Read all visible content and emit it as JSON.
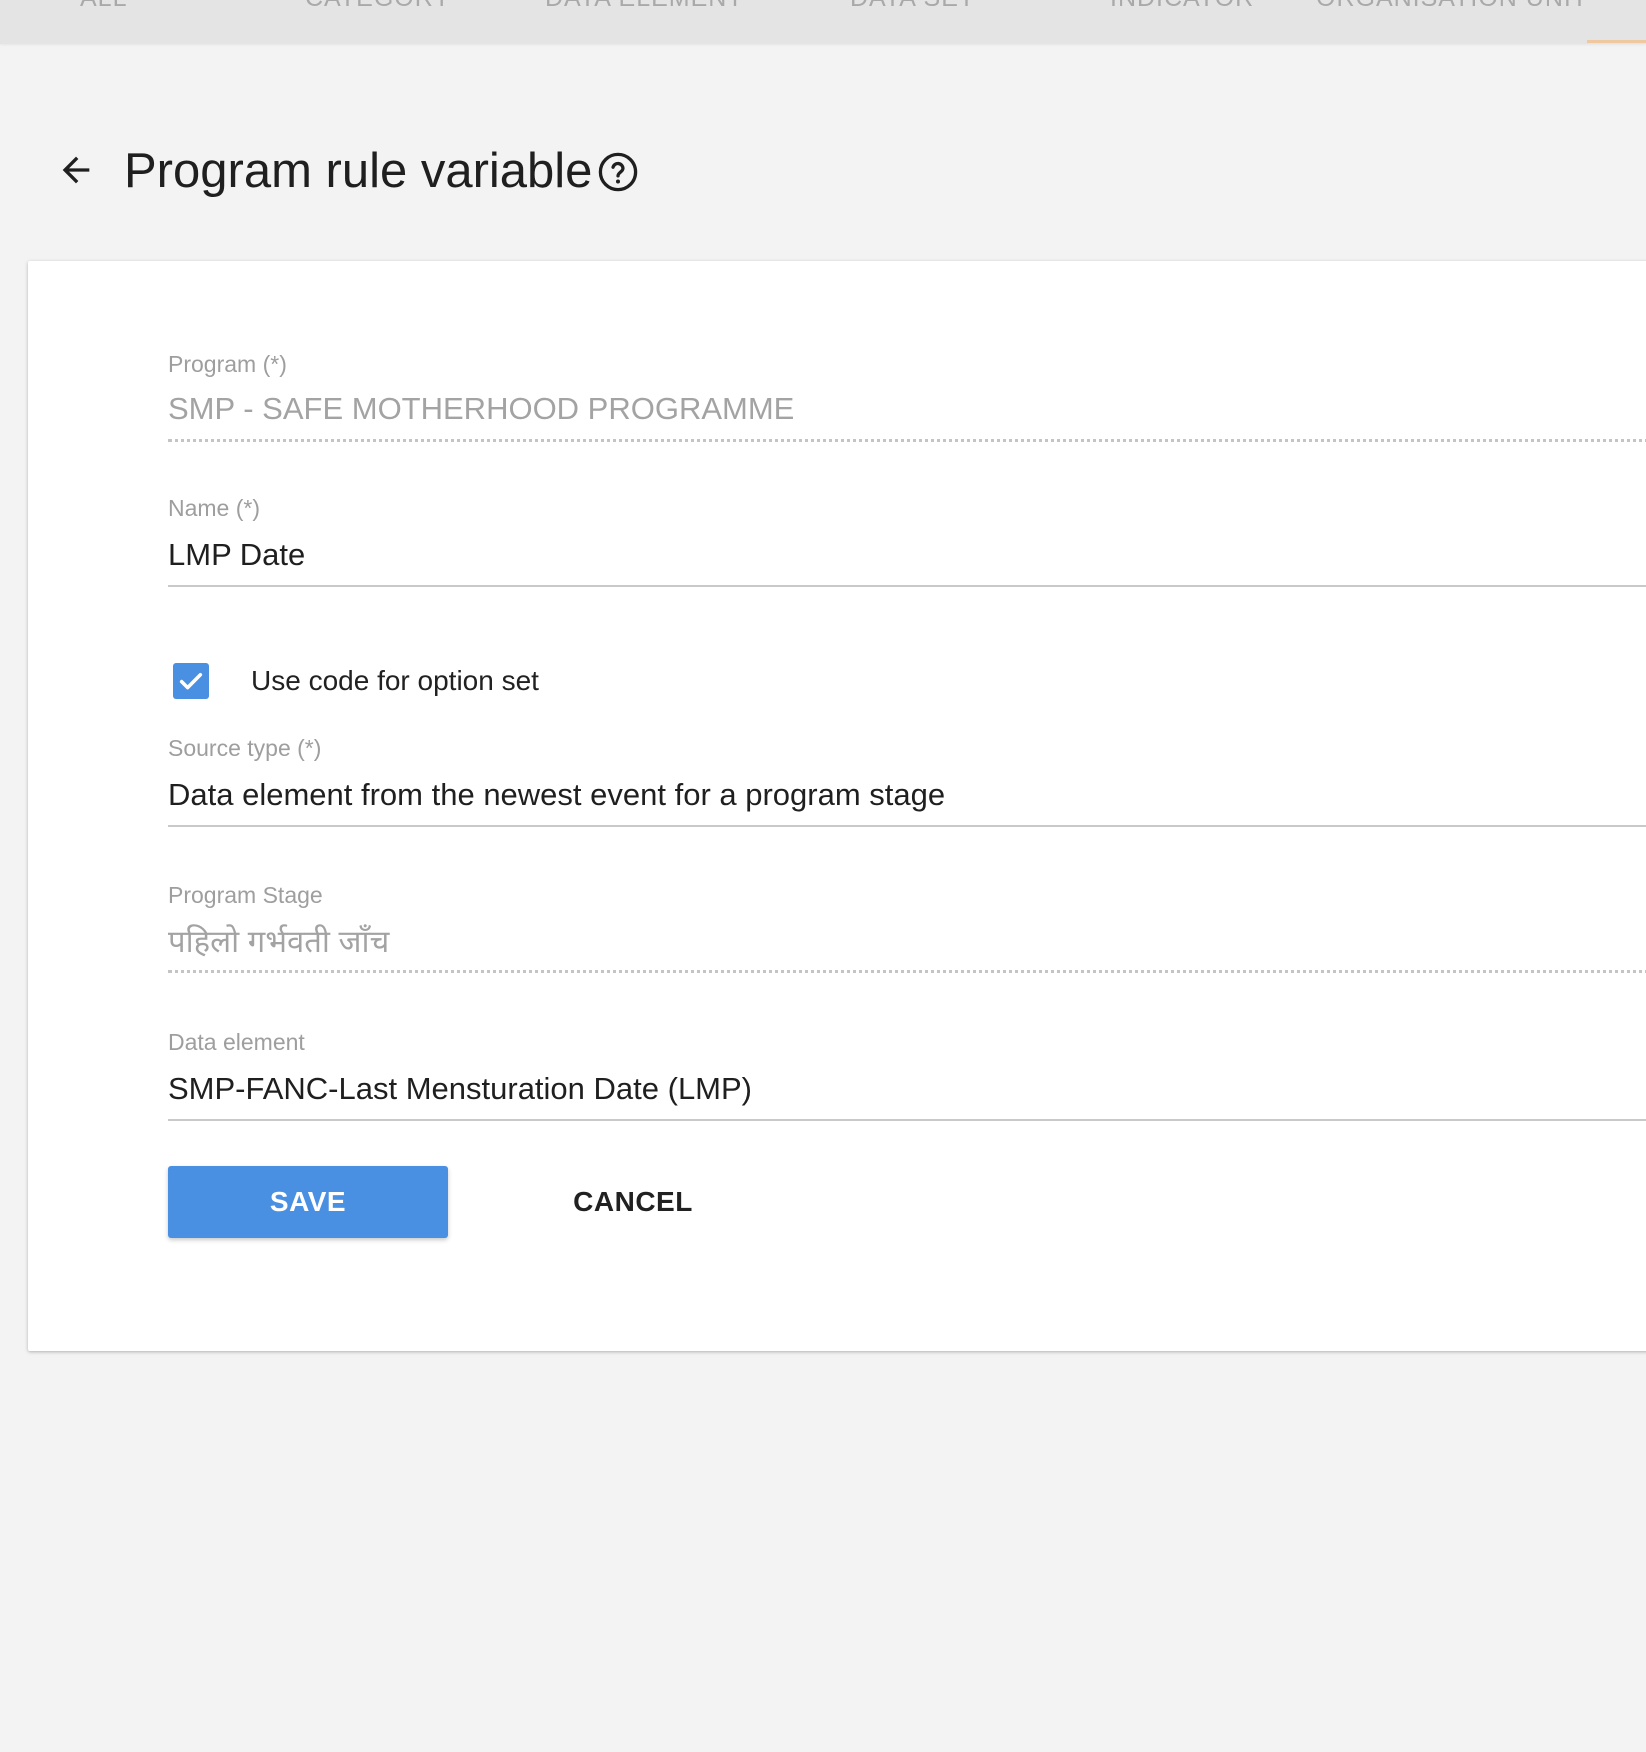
{
  "tabs": [
    {
      "label": "ALL"
    },
    {
      "label": "CATEGORY"
    },
    {
      "label": "DATA ELEMENT"
    },
    {
      "label": "DATA SET"
    },
    {
      "label": "INDICATOR"
    },
    {
      "label": "ORGANISATION UNIT"
    }
  ],
  "header": {
    "back_icon": "arrow-left-icon",
    "title": "Program rule variable",
    "help_icon": "help-circle-icon"
  },
  "form": {
    "program": {
      "label": "Program (*)",
      "value": "SMP - SAFE MOTHERHOOD PROGRAMME"
    },
    "name": {
      "label": "Name (*)",
      "value": "LMP Date"
    },
    "use_code_for_option_set": {
      "label": "Use code for option set",
      "checked": true
    },
    "source_type": {
      "label": "Source type (*)",
      "value": "Data element from the newest event for a program stage"
    },
    "program_stage": {
      "label": "Program Stage",
      "value": "पहिलो गर्भवती जाँच"
    },
    "data_element": {
      "label": "Data element",
      "value": "SMP-FANC-Last Mensturation Date (LMP)"
    }
  },
  "actions": {
    "save_label": "SAVE",
    "cancel_label": "CANCEL"
  },
  "colors": {
    "primary": "#4a90e2",
    "background": "#f3f3f3",
    "card": "#ffffff",
    "tab_indicator": "#f0c8a0"
  }
}
